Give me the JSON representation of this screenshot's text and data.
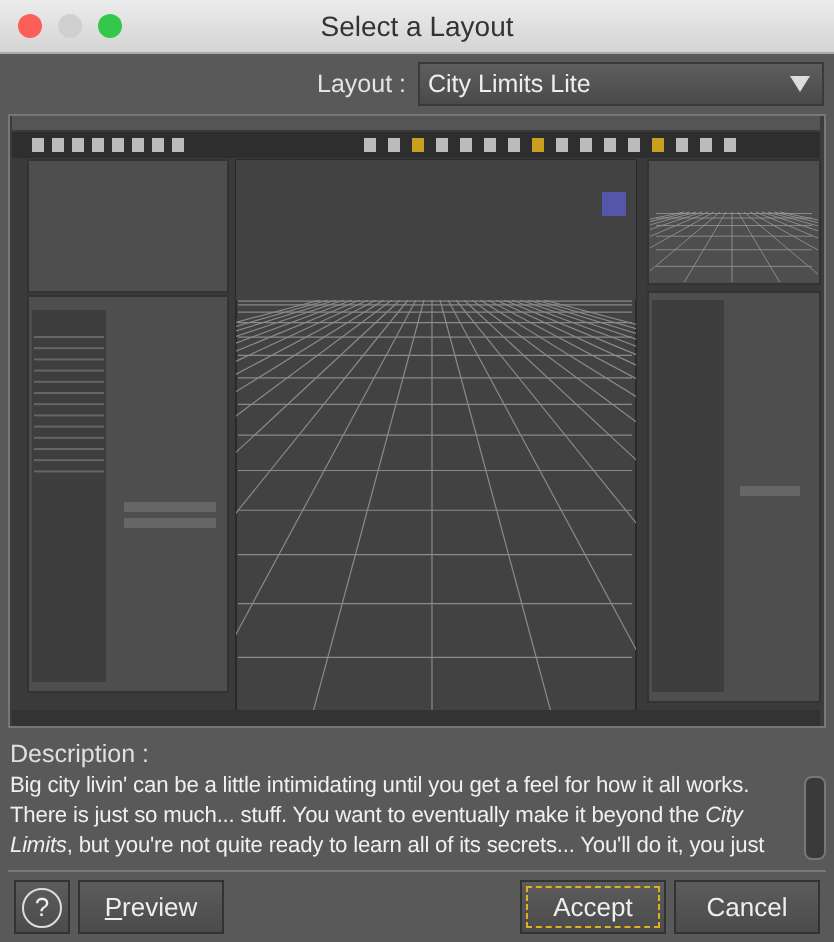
{
  "window": {
    "title": "Select a Layout"
  },
  "layout_select": {
    "label": "Layout :",
    "value": "City Limits Lite"
  },
  "description": {
    "label": "Description :",
    "text": "Big city livin' can be a little intimidating until you get a feel for how it all works. There is just so much... stuff. You want to eventually make it beyond the *City Limits*, but you're not quite ready to learn all of its secrets... You'll do it, you just"
  },
  "buttons": [
    {
      "kind": "help",
      "label": "?",
      "focused": false
    },
    {
      "kind": "mnemonic",
      "label": "Preview",
      "focused": false
    },
    {
      "kind": "plain",
      "label": "Accept",
      "focused": true
    },
    {
      "kind": "plain",
      "label": "Cancel",
      "focused": false
    }
  ]
}
